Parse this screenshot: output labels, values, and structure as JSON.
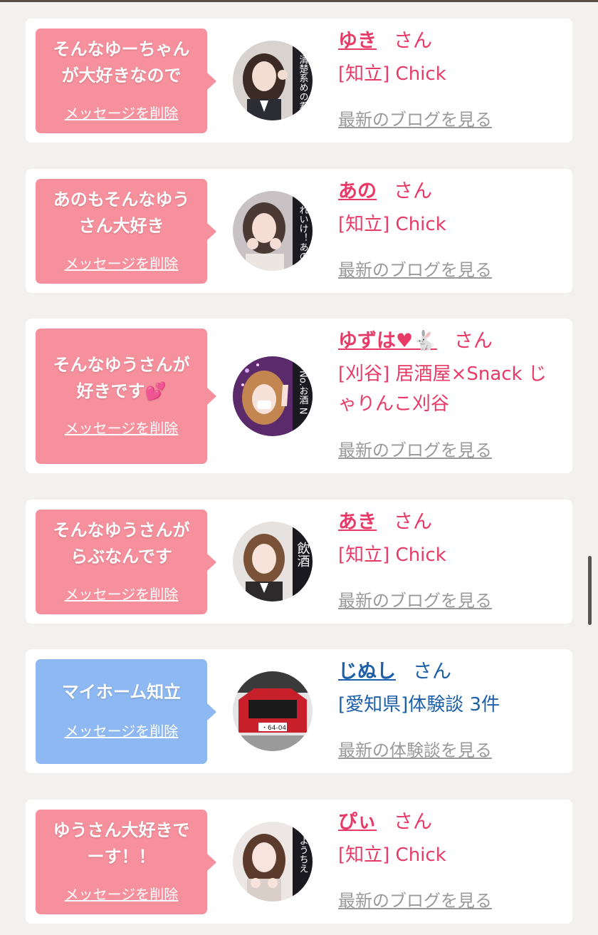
{
  "colors": {
    "pink_bubble": "#f7909d",
    "blue_bubble": "#8db8f2",
    "pink_text": "#e83a66",
    "blue_text": "#1d5fa8",
    "link_gray": "#9a9a9a"
  },
  "items": [
    {
      "message": "そんなゆーちゃん\nが大好きなので",
      "delete_label": "メッセージを削除",
      "name": "ゆき",
      "honorific": "さん",
      "shop": "[知立] Chick",
      "link": "最新のブログを見る",
      "bubble_color": "pink",
      "avatar_caption": "清楚系めの君"
    },
    {
      "message": "あのもそんなゆう\nさん大好き",
      "delete_label": "メッセージを削除",
      "name": "あの",
      "honorific": "さん",
      "shop": "[知立] Chick",
      "link": "最新のブログを見る",
      "bubble_color": "pink",
      "avatar_caption": "れいけ！あの"
    },
    {
      "message": "そんなゆうさんが\n好きです💕",
      "delete_label": "メッセージを削除",
      "name": "ゆずは♥🐇",
      "honorific": "さん",
      "shop": "[刈谷] 居酒屋×Snack じゃりんこ刈谷",
      "link": "最新のブログを見る",
      "bubble_color": "pink",
      "avatar_caption": "No.お酒 N"
    },
    {
      "message": "そんなゆうさんが\nらぶなんです",
      "delete_label": "メッセージを削除",
      "name": "あき",
      "honorific": "さん",
      "shop": "[知立] Chick",
      "link": "最新のブログを見る",
      "bubble_color": "pink",
      "avatar_caption": "飲酒"
    },
    {
      "message": "マイホーム知立",
      "delete_label": "メッセージを削除",
      "name": "じぬし",
      "honorific": "さん",
      "shop": "[愛知県]体験談 3件",
      "link": "最新の体験談を見る",
      "bubble_color": "blue",
      "avatar_caption": "・64-04"
    },
    {
      "message": "ゆうさん大好きで\nーす！！",
      "delete_label": "メッセージを削除",
      "name": "ぴぃ",
      "honorific": "さん",
      "shop": "[知立] Chick",
      "link": "最新のブログを見る",
      "bubble_color": "pink",
      "avatar_caption": "ようちえ"
    }
  ]
}
